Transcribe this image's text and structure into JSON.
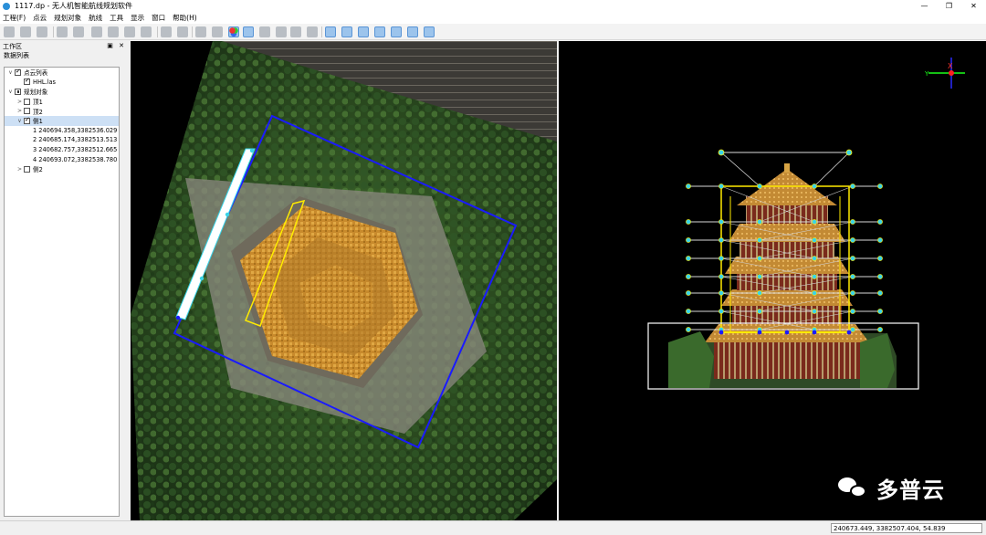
{
  "window": {
    "title": "1117.dp - 无人机智能航线规划软件",
    "controls": [
      "—",
      "❐",
      "✕"
    ]
  },
  "menu": [
    "工程(F)",
    "点云",
    "规划对象",
    "航线",
    "工具",
    "显示",
    "窗口",
    "帮助(H)"
  ],
  "work_panel": {
    "title": "工作区",
    "controls": "▣ ✕",
    "tab": "数据列表",
    "tree": [
      {
        "label": "点云列表",
        "expander": "∨",
        "check": "checked",
        "indent": 0
      },
      {
        "label": "HHL.las",
        "expander": "",
        "check": "checked",
        "indent": 1
      },
      {
        "label": "规划对象",
        "expander": "∨",
        "check": "partial",
        "indent": 0
      },
      {
        "label": "顶1",
        "expander": ">",
        "check": "none",
        "indent": 1
      },
      {
        "label": "顶2",
        "expander": ">",
        "check": "none",
        "indent": 1
      },
      {
        "label": "侧1",
        "expander": "∨",
        "check": "checked",
        "indent": 1,
        "selected": true
      },
      {
        "label": "1 240694.358,3382536.029",
        "expander": "",
        "check": "",
        "indent": 2
      },
      {
        "label": "2 240685.174,3382513.513",
        "expander": "",
        "check": "",
        "indent": 2
      },
      {
        "label": "3 240682.757,3382512.665",
        "expander": "",
        "check": "",
        "indent": 2
      },
      {
        "label": "4 240693.072,3382538.780",
        "expander": "",
        "check": "",
        "indent": 2
      },
      {
        "label": "侧2",
        "expander": ">",
        "check": "none",
        "indent": 1
      }
    ]
  },
  "views": {
    "left": "top-view-point-cloud",
    "right": "side-view-point-cloud",
    "colors": {
      "route": "#1a1aff",
      "frame": "#ffeb00",
      "waypoint": "#39d4e8",
      "strip": "#ffffff"
    }
  },
  "axis_indicator": {
    "label_x": "X",
    "label_y": "Y"
  },
  "status": {
    "coordinates": "240673.449, 3382507.404, 54.839"
  },
  "watermark": {
    "text": "多普云"
  },
  "toolbar_icons": [
    "open-icon",
    "undo-icon",
    "globe-icon",
    "crop-icon",
    "grid-icon",
    "layer-icon",
    "layer2-icon",
    "layer3-icon",
    "export-icon",
    "ruler-icon",
    "list-icon",
    "zoom-in-icon",
    "zoom-out-icon",
    "settings-icon",
    "rgb-icon",
    "text-icon",
    "menu-icon",
    "page-icon",
    "page2-icon",
    "measure-icon",
    "line-icon",
    "ld-icon",
    "tag-icon",
    "ld2-icon",
    "tag2-icon",
    "angle-icon"
  ]
}
